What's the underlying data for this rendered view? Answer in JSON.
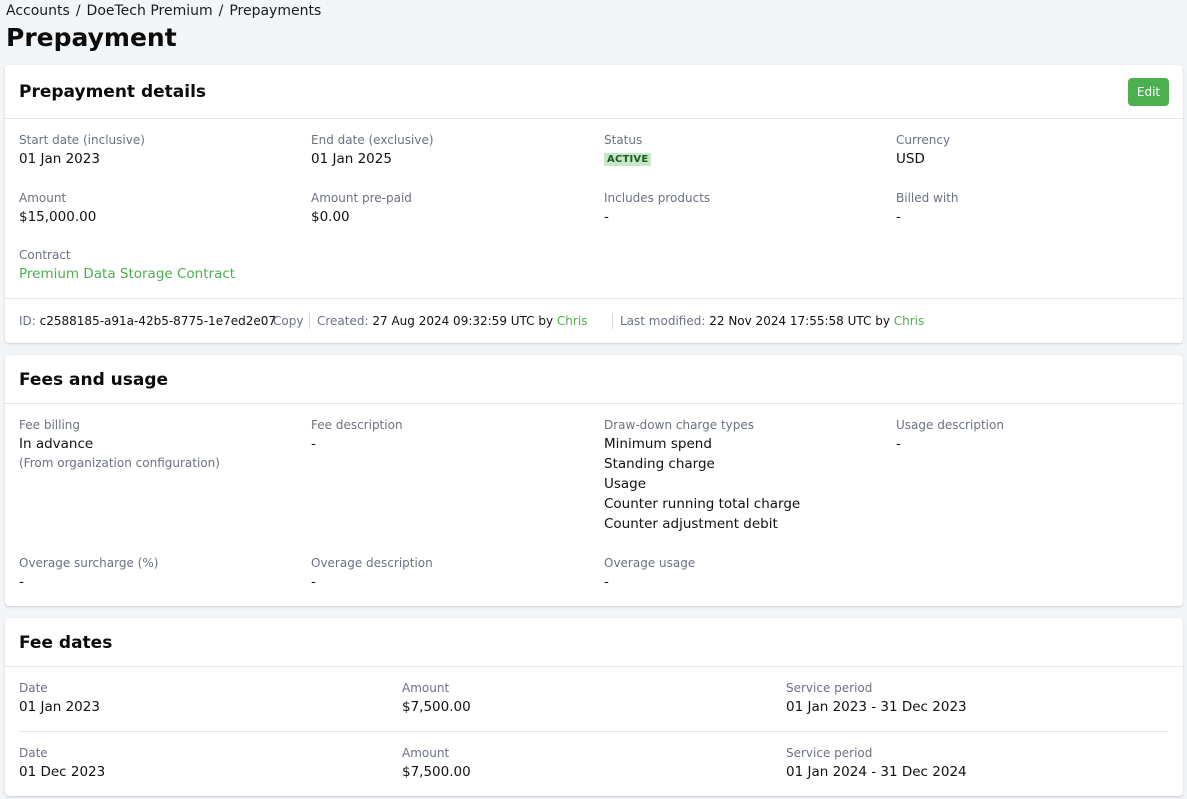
{
  "breadcrumb": {
    "items": [
      "Accounts",
      "DoeTech Premium",
      "Prepayments"
    ],
    "separator": "/"
  },
  "page_title": "Prepayment",
  "details": {
    "title": "Prepayment details",
    "edit_label": "Edit",
    "start_date": {
      "label": "Start date (inclusive)",
      "value": "01 Jan 2023"
    },
    "end_date": {
      "label": "End date (exclusive)",
      "value": "01 Jan 2025"
    },
    "status": {
      "label": "Status",
      "value": "ACTIVE"
    },
    "currency": {
      "label": "Currency",
      "value": "USD"
    },
    "amount": {
      "label": "Amount",
      "value": "$15,000.00"
    },
    "amount_prepaid": {
      "label": "Amount pre-paid",
      "value": "$0.00"
    },
    "includes_products": {
      "label": "Includes products",
      "value": "-"
    },
    "billed_with": {
      "label": "Billed with",
      "value": "-"
    },
    "contract": {
      "label": "Contract",
      "value": "Premium Data Storage Contract"
    },
    "meta": {
      "id_label": "ID:",
      "id_value": "c2588185-a91a-42b5-8775-1e7ed2e07",
      "copy_label": "Copy",
      "created_label": "Created:",
      "created_value": "27 Aug 2024 09:32:59 UTC by",
      "created_by": "Chris",
      "modified_label": "Last modified:",
      "modified_value": "22 Nov 2024 17:55:58 UTC by",
      "modified_by": "Chris"
    }
  },
  "fees": {
    "title": "Fees and usage",
    "fee_billing": {
      "label": "Fee billing",
      "value": "In advance",
      "note": "(From organization configuration)"
    },
    "fee_description": {
      "label": "Fee description",
      "value": "-"
    },
    "drawdown": {
      "label": "Draw-down charge types",
      "values": [
        "Minimum spend",
        "Standing charge",
        "Usage",
        "Counter running total charge",
        "Counter adjustment debit"
      ]
    },
    "usage_description": {
      "label": "Usage description",
      "value": "-"
    },
    "overage_surcharge": {
      "label": "Overage surcharge (%)",
      "value": "-"
    },
    "overage_description": {
      "label": "Overage description",
      "value": "-"
    },
    "overage_usage": {
      "label": "Overage usage",
      "value": "-"
    }
  },
  "fee_dates": {
    "title": "Fee dates",
    "col_labels": {
      "date": "Date",
      "amount": "Amount",
      "period": "Service period"
    },
    "rows": [
      {
        "date": "01 Jan 2023",
        "amount": "$7,500.00",
        "period": "01 Jan 2023 - 31 Dec 2023"
      },
      {
        "date": "01 Dec 2023",
        "amount": "$7,500.00",
        "period": "01 Jan 2024 - 31 Dec 2024"
      }
    ]
  },
  "colors": {
    "accent": "#4caf50",
    "badge_bg": "#c8e6c9",
    "badge_text": "#1b5e20",
    "background": "#f3f6f9"
  }
}
